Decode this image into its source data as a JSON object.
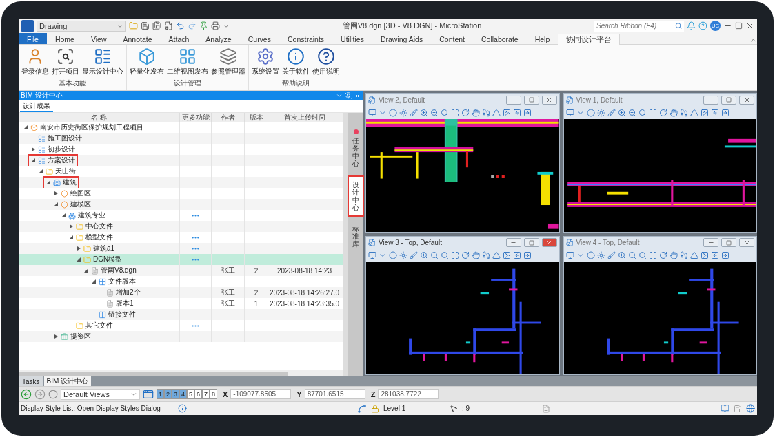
{
  "app": {
    "workspace": "Drawing",
    "title": "管网V8.dgn [3D - V8 DGN] - MicroStation",
    "search": {
      "placeholder": "Search Ribbon (F4)"
    },
    "user_initials": "UC"
  },
  "ribbon_tabs": [
    {
      "label": "File",
      "selected": false,
      "kind": "file"
    },
    {
      "label": "Home",
      "selected": false,
      "kind": "tab"
    },
    {
      "label": "View",
      "selected": false,
      "kind": "tab"
    },
    {
      "label": "Annotate",
      "selected": false,
      "kind": "tab"
    },
    {
      "label": "Attach",
      "selected": false,
      "kind": "tab"
    },
    {
      "label": "Analyze",
      "selected": false,
      "kind": "tab"
    },
    {
      "label": "Curves",
      "selected": false,
      "kind": "tab"
    },
    {
      "label": "Constraints",
      "selected": false,
      "kind": "tab"
    },
    {
      "label": "Utilities",
      "selected": false,
      "kind": "tab"
    },
    {
      "label": "Drawing Aids",
      "selected": false,
      "kind": "tab"
    },
    {
      "label": "Content",
      "selected": false,
      "kind": "tab"
    },
    {
      "label": "Collaborate",
      "selected": false,
      "kind": "tab"
    },
    {
      "label": "Help",
      "selected": false,
      "kind": "tab"
    },
    {
      "label": "协同设计平台",
      "selected": true,
      "kind": "tab"
    }
  ],
  "ribbon_groups": [
    {
      "label": "基本功能",
      "buttons": [
        {
          "label": "登录信息",
          "kind": "user"
        },
        {
          "label": "打开项目",
          "kind": "open"
        },
        {
          "label": "显示设计中心",
          "kind": "list"
        }
      ]
    },
    {
      "label": "设计管理",
      "buttons": [
        {
          "label": "轻量化发布",
          "kind": "publish"
        },
        {
          "label": "二维视图发布",
          "kind": "plan"
        },
        {
          "label": "参照管理器",
          "kind": "reference"
        }
      ]
    },
    {
      "label": "帮助说明",
      "buttons": [
        {
          "label": "系统设置",
          "kind": "settings"
        },
        {
          "label": "关于软件",
          "kind": "info"
        },
        {
          "label": "使用说明",
          "kind": "help"
        }
      ]
    }
  ],
  "panel": {
    "title": "BIM 设计中心",
    "tab": "设计成果",
    "columns": [
      "名 称",
      "更多功能",
      "作者",
      "版本",
      "首次上传时间"
    ],
    "rows": [
      {
        "name": "南安市历史街区保护规划工程项目",
        "kind": "project",
        "expanded": true,
        "selected": false,
        "children": [
          {
            "name": "施工图设计",
            "kind": "stage",
            "selected": false
          },
          {
            "name": "初步设计",
            "kind": "stage",
            "expanded": false,
            "selected": false
          },
          {
            "name": "方案设计",
            "kind": "stage",
            "expanded": true,
            "selected": false,
            "highlighted": true,
            "children": [
              {
                "name": "天山街",
                "kind": "folder",
                "expanded": true,
                "selected": false,
                "children": [
                  {
                    "name": "建筑",
                    "kind": "building",
                    "expanded": true,
                    "selected": false,
                    "highlighted": true,
                    "children": [
                      {
                        "name": "绘图区",
                        "kind": "zone",
                        "expanded": false,
                        "selected": false
                      },
                      {
                        "name": "建模区",
                        "kind": "zone",
                        "expanded": true,
                        "selected": false,
                        "children": [
                          {
                            "name": "建筑专业",
                            "kind": "discipline",
                            "expanded": true,
                            "selected": false,
                            "more": true,
                            "children": [
                              {
                                "name": "中心文件",
                                "kind": "folder",
                                "expanded": false,
                                "selected": false
                              },
                              {
                                "name": "模型文件",
                                "kind": "folder",
                                "expanded": true,
                                "selected": false,
                                "more": true,
                                "children": [
                                  {
                                    "name": "建筑a1",
                                    "kind": "folder",
                                    "expanded": false,
                                    "selected": false,
                                    "more": true
                                  },
                                  {
                                    "name": "DGN模型",
                                    "kind": "folder",
                                    "expanded": true,
                                    "selected": true,
                                    "more": true,
                                    "children": [
                                      {
                                        "name": "管网V8.dgn",
                                        "kind": "file",
                                        "expanded": true,
                                        "selected": false,
                                        "author": "张工",
                                        "version": "2",
                                        "time": "2023-08-18 14:23",
                                        "children": [
                                          {
                                            "name": "文件版本",
                                            "kind": "group",
                                            "expanded": true,
                                            "selected": false,
                                            "children": [
                                              {
                                                "name": "增加2个",
                                                "kind": "file",
                                                "selected": false,
                                                "author": "张工",
                                                "version": "2",
                                                "time": "2023-08-18 14:26:27.0"
                                              },
                                              {
                                                "name": "版本1",
                                                "kind": "file",
                                                "selected": false,
                                                "author": "张工",
                                                "version": "1",
                                                "time": "2023-08-18 14:23:35.0"
                                              }
                                            ]
                                          },
                                          {
                                            "name": "链接文件",
                                            "kind": "group",
                                            "selected": false
                                          }
                                        ]
                                      }
                                    ]
                                  }
                                ]
                              },
                              {
                                "name": "其它文件",
                                "kind": "folder",
                                "selected": false,
                                "more": true
                              }
                            ]
                          }
                        ]
                      },
                      {
                        "name": "提资区",
                        "kind": "exchange",
                        "expanded": false,
                        "selected": false
                      }
                    ]
                  }
                ]
              }
            ]
          }
        ]
      }
    ],
    "side_tabs": [
      {
        "label": "任务中心",
        "selected": false,
        "alert": true,
        "highlighted": false
      },
      {
        "label": "设计中心",
        "selected": true,
        "alert": false,
        "highlighted": true
      },
      {
        "label": "标准库",
        "selected": false,
        "alert": false,
        "highlighted": false
      }
    ]
  },
  "views": [
    {
      "title": "View 2, Default",
      "active": false,
      "kind": "elevation"
    },
    {
      "title": "View 1, Default",
      "active": false,
      "kind": "section"
    },
    {
      "title": "View 3 - Top, Default",
      "active": true,
      "kind": "plan"
    },
    {
      "title": "View 4 - Top, Default",
      "active": false,
      "kind": "plan"
    }
  ],
  "dock_tabs": [
    {
      "label": "Tasks",
      "selected": false
    },
    {
      "label": "BIM 设计中心",
      "selected": true
    }
  ],
  "toolbar": {
    "view_group": "Default Views",
    "view_buttons": [
      {
        "label": "1",
        "selected": true
      },
      {
        "label": "2",
        "selected": true
      },
      {
        "label": "3",
        "selected": true
      },
      {
        "label": "4",
        "selected": true
      },
      {
        "label": "5",
        "selected": false
      },
      {
        "label": "6",
        "selected": false
      },
      {
        "label": "7",
        "selected": false
      },
      {
        "label": "8",
        "selected": false
      }
    ],
    "coordinates": [
      {
        "label": "X",
        "value": "-109077.8505"
      },
      {
        "label": "Y",
        "value": "87701.6515"
      },
      {
        "label": "Z",
        "value": "281038.7722"
      }
    ]
  },
  "status_bar": {
    "message": "Display Style List: Open Display Styles Dialog",
    "level": "Level 1",
    "selection": ": 9"
  }
}
